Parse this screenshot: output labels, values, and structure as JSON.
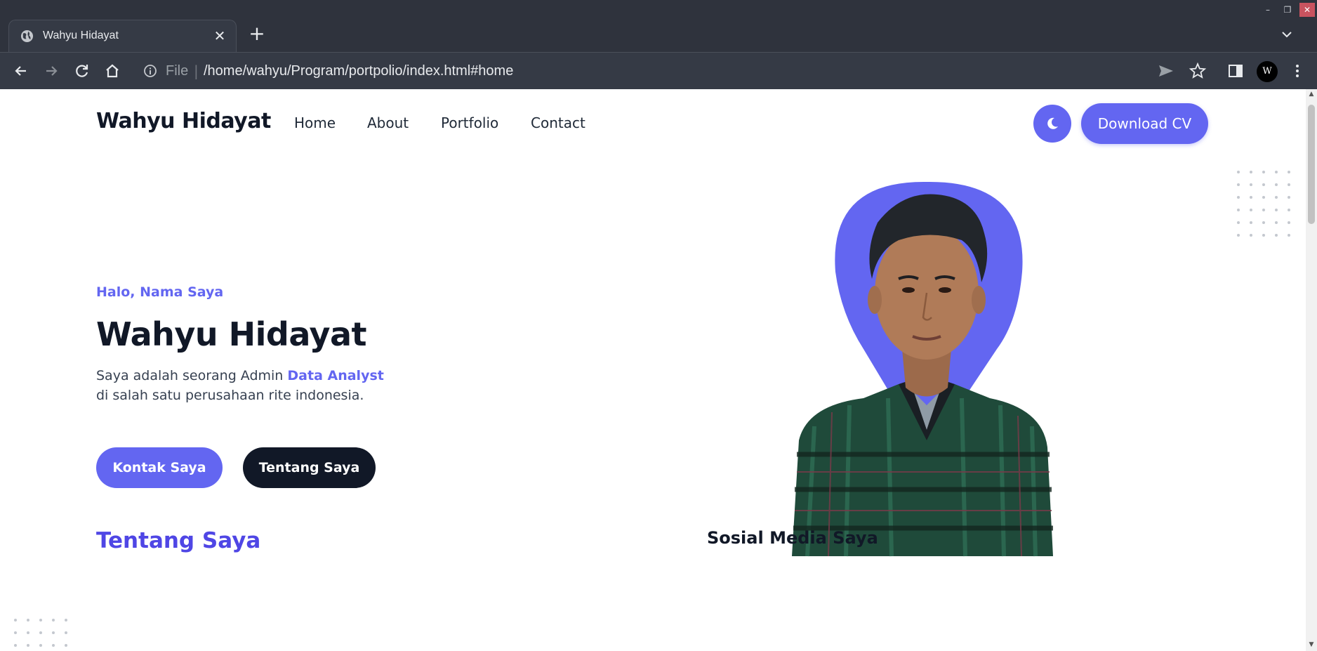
{
  "browser": {
    "tab_title": "Wahyu Hidayat",
    "new_tab_label": "+",
    "url_scheme": "File",
    "url_separator": "|",
    "url": "/home/wahyu/Program/portpolio/index.html#home",
    "profile_initial": "W"
  },
  "header": {
    "brand": "Wahyu Hidayat",
    "nav": [
      "Home",
      "About",
      "Portfolio",
      "Contact"
    ],
    "download_cv": "Download CV"
  },
  "hero": {
    "greeting": "Halo, Nama Saya",
    "name": "Wahyu Hidayat",
    "desc_prefix": "Saya adalah seorang Admin ",
    "desc_highlight": "Data Analyst",
    "desc_line2": "di salah satu perusahaan rite indonesia.",
    "btn_contact": "Kontak Saya",
    "btn_about": "Tentang Saya"
  },
  "sections": {
    "about_title": "Tentang Saya",
    "social_title": "Sosial Media Saya"
  },
  "colors": {
    "accent": "#6366f1",
    "dark": "#111827",
    "chrome": "#2f333d"
  },
  "icons": [
    "globe-icon",
    "close-icon",
    "plus-icon",
    "chevron-down-icon",
    "back-icon",
    "forward-icon",
    "reload-icon",
    "home-icon",
    "info-icon",
    "send-icon",
    "star-icon",
    "sidepanel-icon",
    "kebab-menu-icon",
    "moon-icon"
  ]
}
